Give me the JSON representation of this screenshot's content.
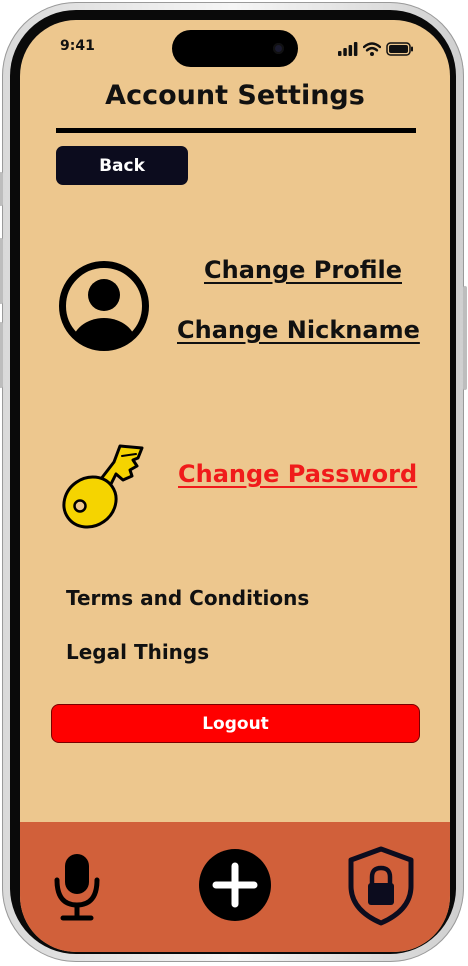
{
  "status_bar": {
    "time": "9:41",
    "icons": [
      "signal-icon",
      "wifi-icon",
      "battery-icon"
    ]
  },
  "header": {
    "title": "Account Settings"
  },
  "back_button": {
    "label": "Back"
  },
  "profile_section": {
    "icon": "user-avatar-icon",
    "change_profile": "Change Profile",
    "change_nickname": "Change Nickname"
  },
  "password_section": {
    "icon": "key-icon",
    "change_password": "Change Password"
  },
  "links": {
    "terms": "Terms and Conditions",
    "legal": "Legal Things"
  },
  "logout_button": {
    "label": "Logout"
  },
  "bottom_nav": {
    "items": [
      "microphone-icon",
      "add-icon",
      "lock-shield-icon"
    ]
  },
  "colors": {
    "background": "#edc78e",
    "bottom_bar": "#d1603a",
    "danger": "#ff0000",
    "dark": "#0c0c1e",
    "key_yellow": "#f5d400"
  }
}
